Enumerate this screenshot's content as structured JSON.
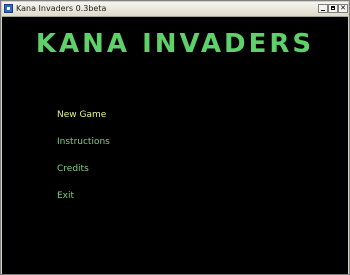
{
  "window": {
    "title": "Kana Invaders 0.3beta"
  },
  "game": {
    "title": "KANA INVADERS",
    "title_color": "#5fd16a",
    "background": "#000000"
  },
  "menu": {
    "selected_color": "#e8f08a",
    "item_color": "#7ed07c",
    "items": [
      {
        "label": "New Game",
        "selected": true
      },
      {
        "label": "Instructions",
        "selected": false
      },
      {
        "label": "Credits",
        "selected": false
      },
      {
        "label": "Exit",
        "selected": false
      }
    ]
  }
}
